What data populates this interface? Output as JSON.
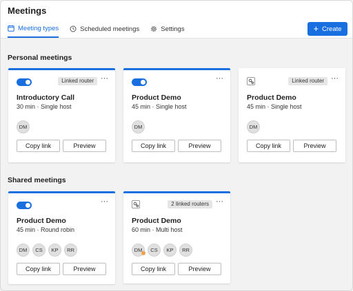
{
  "header": {
    "title": "Meetings",
    "tabs": [
      {
        "label": "Meeting types",
        "icon": "calendar-icon",
        "active": true
      },
      {
        "label": "Scheduled meetings",
        "icon": "clock-icon",
        "active": false
      },
      {
        "label": "Settings",
        "icon": "gear-icon",
        "active": false
      }
    ],
    "create_label": "Create"
  },
  "sections": {
    "personal": "Personal meetings",
    "shared": "Shared meetings"
  },
  "cards": [
    {
      "name": "Introductory Call",
      "sub": "30 min · Single host",
      "toggle": true,
      "badge": "Linked router",
      "avatars": [
        "DM"
      ],
      "copy": "Copy link",
      "preview": "Preview"
    },
    {
      "name": "Product Demo",
      "sub": "45 min · Single host",
      "toggle": true,
      "badge": "",
      "avatars": [
        "DM"
      ],
      "copy": "Copy link",
      "preview": "Preview"
    },
    {
      "name": "Product Demo",
      "sub": "45 min · Single host",
      "toggle": false,
      "badge": "Linked router",
      "avatars": [
        "DM"
      ],
      "copy": "Copy link",
      "preview": "Preview"
    },
    {
      "name": "Product Demo",
      "sub": "45 min · Round robin",
      "toggle": true,
      "badge": "",
      "avatars": [
        "DM",
        "CS",
        "KP",
        "RR"
      ],
      "copy": "Copy link",
      "preview": "Preview"
    },
    {
      "name": "Product Demo",
      "sub": "60 min · Multi host",
      "toggle": false,
      "badge": "2 linked routers",
      "avatars": [
        "DM",
        "CS",
        "KP",
        "RR"
      ],
      "copy": "Copy link",
      "preview": "Preview"
    }
  ],
  "colors": {
    "accent": "#1a6fe0",
    "background": "#f2f2f2",
    "card": "#ffffff"
  }
}
